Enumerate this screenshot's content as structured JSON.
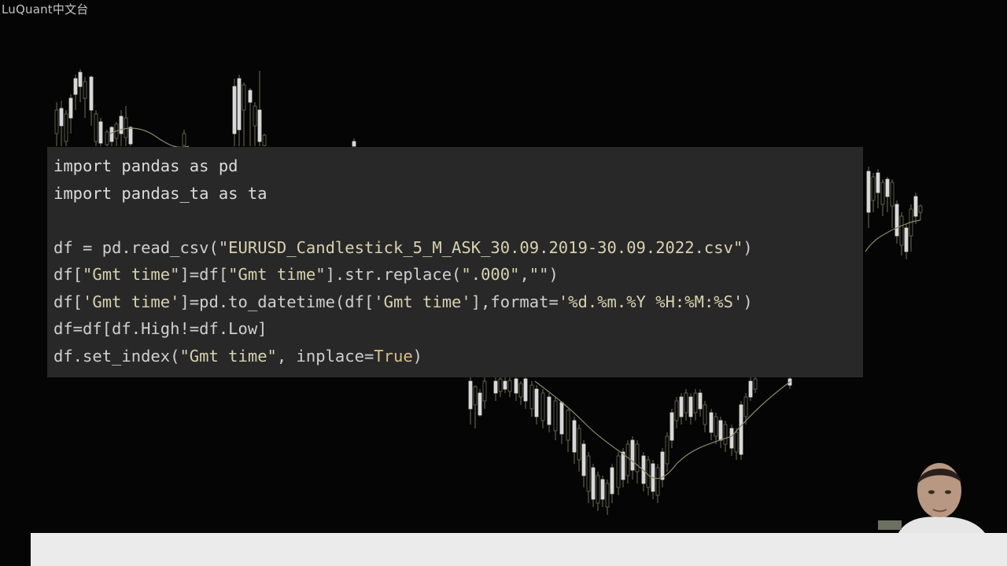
{
  "watermark": {
    "text": "LuQuant中文台"
  },
  "code": {
    "lines": [
      {
        "parts": [
          {
            "t": "import pandas as pd",
            "c": "kw"
          }
        ]
      },
      {
        "parts": [
          {
            "t": "import pandas_ta as ta",
            "c": "kw"
          }
        ]
      },
      {
        "parts": [
          {
            "t": "",
            "c": ""
          }
        ]
      },
      {
        "parts": [
          {
            "t": "df = pd.read_csv(",
            "c": ""
          },
          {
            "t": "\"EURUSD_Candlestick_5_M_ASK_30.09.2019-30.09.2022.csv\"",
            "c": "str"
          },
          {
            "t": ")",
            "c": ""
          }
        ]
      },
      {
        "parts": [
          {
            "t": "df[",
            "c": ""
          },
          {
            "t": "\"Gmt time\"",
            "c": "str"
          },
          {
            "t": "]=df[",
            "c": ""
          },
          {
            "t": "\"Gmt time\"",
            "c": "str"
          },
          {
            "t": "].str.replace(",
            "c": ""
          },
          {
            "t": "\".000\"",
            "c": "str"
          },
          {
            "t": ",",
            "c": ""
          },
          {
            "t": "\"\"",
            "c": "str"
          },
          {
            "t": ")",
            "c": ""
          }
        ]
      },
      {
        "parts": [
          {
            "t": "df[",
            "c": ""
          },
          {
            "t": "'Gmt time'",
            "c": "str"
          },
          {
            "t": "]=pd.to_datetime(df[",
            "c": ""
          },
          {
            "t": "'Gmt time'",
            "c": "str"
          },
          {
            "t": "],format=",
            "c": ""
          },
          {
            "t": "'%d.%m.%Y %H:%M:%S'",
            "c": "str"
          },
          {
            "t": ")",
            "c": ""
          }
        ]
      },
      {
        "parts": [
          {
            "t": "df=df[df.High!=df.Low]",
            "c": ""
          }
        ]
      },
      {
        "parts": [
          {
            "t": "df.set_index(",
            "c": ""
          },
          {
            "t": "\"Gmt time\"",
            "c": "str"
          },
          {
            "t": ", inplace=",
            "c": ""
          },
          {
            "t": "True",
            "c": "tok-true"
          },
          {
            "t": ")",
            "c": ""
          }
        ]
      }
    ]
  },
  "colors": {
    "background": "#050505",
    "code_panel": "#282828",
    "code_text": "#cfcfcf",
    "candle_bull": "#d8d8d8",
    "candle_bear": "#6e6e58",
    "moving_average": "#8a8a6a",
    "bottom_bar": "#ebebeb"
  }
}
